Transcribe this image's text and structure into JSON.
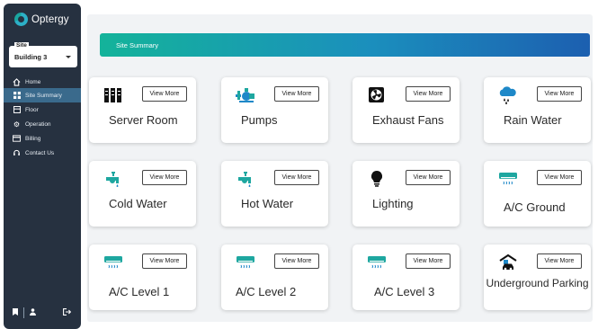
{
  "brand": {
    "name": "Optergy"
  },
  "site_selector": {
    "legend": "Site",
    "value": "Building 3"
  },
  "nav": {
    "home": "Home",
    "site_summary": "Site Summary",
    "floor": "Floor",
    "operation": "Operation",
    "billing": "Billing",
    "contact_us": "Contact Us"
  },
  "banner": {
    "title": "Site Summary"
  },
  "view_more_label": "View More",
  "cards": [
    {
      "title": "Server Room",
      "icon": "server-icon"
    },
    {
      "title": "Pumps",
      "icon": "pump-icon"
    },
    {
      "title": "Exhaust Fans",
      "icon": "fan-icon"
    },
    {
      "title": "Rain Water",
      "icon": "rain-cloud-icon"
    },
    {
      "title": "Cold Water",
      "icon": "faucet-icon"
    },
    {
      "title": "Hot Water",
      "icon": "faucet-icon"
    },
    {
      "title": "Lighting",
      "icon": "lightbulb-icon"
    },
    {
      "title": "A/C Ground",
      "icon": "air-conditioner-icon"
    },
    {
      "title": "A/C Level 1",
      "icon": "air-conditioner-icon"
    },
    {
      "title": "A/C Level 2",
      "icon": "air-conditioner-icon"
    },
    {
      "title": "A/C Level 3",
      "icon": "air-conditioner-icon"
    },
    {
      "title": "Underground Parking",
      "icon": "parking-garage-icon"
    }
  ],
  "colors": {
    "sidebar": "#263140",
    "active_nav": "#3a6a8c",
    "banner_start": "#14b39a",
    "banner_end": "#1c5fb0",
    "icon_teal": "#1ea7a0",
    "icon_blue": "#1e88c8"
  }
}
